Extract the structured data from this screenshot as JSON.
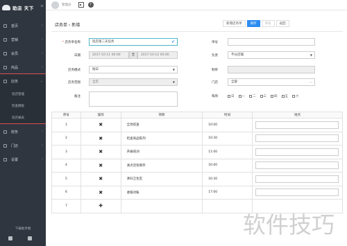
{
  "brand": {
    "title": "助店 天下"
  },
  "sidebar": {
    "items": [
      {
        "label": "首页"
      },
      {
        "label": "营销"
      },
      {
        "label": "会员"
      },
      {
        "label": "商品"
      }
    ],
    "group": {
      "label": "店务",
      "subitems": [
        {
          "label": "巡店管理"
        },
        {
          "label": "检查模板"
        },
        {
          "label": "巡店报表"
        }
      ]
    },
    "items_after": [
      {
        "label": "财务"
      },
      {
        "label": "门店"
      },
      {
        "label": "设置"
      }
    ],
    "footer": "下载助手端"
  },
  "topbar": {
    "user_name": "管理员"
  },
  "page": {
    "breadcrumb": "店务单 › 新增",
    "actions": [
      {
        "label": "新增店务单"
      },
      {
        "label": "保存"
      },
      {
        "label": "审核"
      },
      {
        "label": "返回"
      }
    ]
  },
  "form": {
    "name": {
      "label": "店务单名称",
      "value": "巡店第二天任务"
    },
    "date": {
      "label": "日期",
      "start": "2017-10-11 00:00",
      "to": "至",
      "end": "2017-10-12 00:00"
    },
    "mode": {
      "label": "店务模式",
      "value": "按日"
    },
    "scope": {
      "label": "店务范围",
      "value": "全店"
    },
    "remark": {
      "label": "备注"
    },
    "order_no": {
      "label": "单号"
    },
    "executor": {
      "label": "负责",
      "value": "不分店铺"
    },
    "creator": {
      "label": "制单"
    },
    "store": {
      "label": "门店",
      "value": "全部"
    },
    "weekdays": {
      "label": "每周",
      "days": [
        "日",
        "一",
        "二",
        "三",
        "四",
        "五",
        "六"
      ]
    }
  },
  "table": {
    "headers": {
      "no": "序号",
      "op": "操作",
      "name": "项目",
      "time": "时间",
      "place": "地点"
    },
    "rows": [
      {
        "no": "1",
        "op": "✖",
        "name": "全场巡查",
        "time": "10:00"
      },
      {
        "no": "2",
        "op": "✖",
        "name": "检查商品陈列",
        "time": "10:30"
      },
      {
        "no": "3",
        "op": "✖",
        "name": "开展培训",
        "time": "11:00"
      },
      {
        "no": "4",
        "op": "✖",
        "name": "清点货架库存",
        "time": "16:00"
      },
      {
        "no": "5",
        "op": "✖",
        "name": "清扫卫生区",
        "time": "16:30"
      },
      {
        "no": "6",
        "op": "✖",
        "name": "收银对账",
        "time": "17:00"
      },
      {
        "no": "7",
        "op": "✚",
        "name": "",
        "time": ""
      }
    ]
  },
  "watermark": "软件技巧"
}
